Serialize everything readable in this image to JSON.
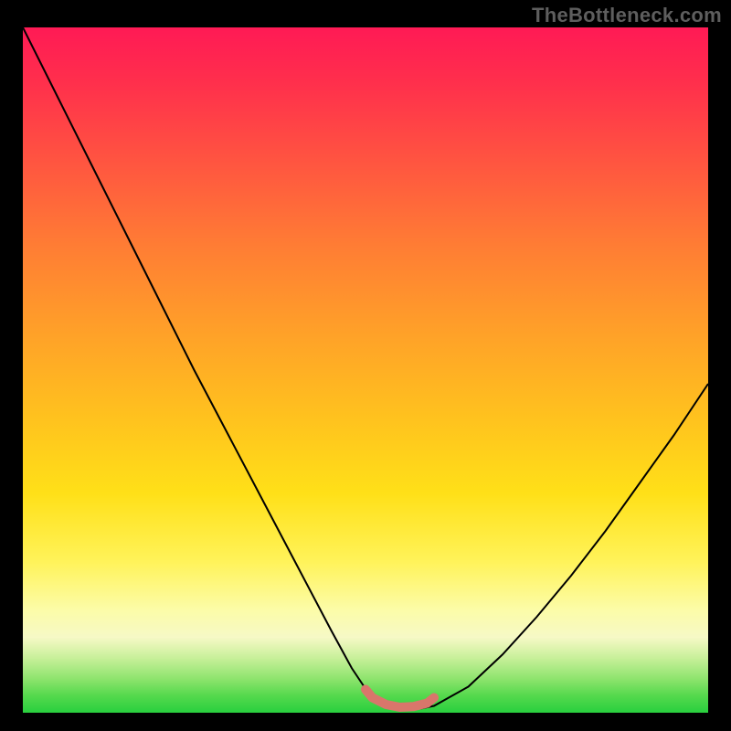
{
  "attribution": "TheBottleneck.com",
  "chart_data": {
    "type": "line",
    "title": "",
    "xlabel": "",
    "ylabel": "",
    "xlim": [
      0,
      100
    ],
    "ylim": [
      0,
      100
    ],
    "grid": false,
    "legend": false,
    "background_gradient_stops": [
      {
        "pos": 0,
        "color": "#ff1a55"
      },
      {
        "pos": 20,
        "color": "#ff5640"
      },
      {
        "pos": 45,
        "color": "#ffa228"
      },
      {
        "pos": 68,
        "color": "#ffe018"
      },
      {
        "pos": 85,
        "color": "#fcfca8"
      },
      {
        "pos": 95,
        "color": "#8fe46e"
      },
      {
        "pos": 100,
        "color": "#28cf3e"
      }
    ],
    "series": [
      {
        "name": "bottleneck-curve",
        "color": "#000000",
        "stroke_width": 2,
        "x": [
          0,
          5,
          10,
          15,
          20,
          25,
          30,
          35,
          40,
          45,
          48,
          50,
          52,
          55,
          58,
          60,
          65,
          70,
          75,
          80,
          85,
          90,
          95,
          100
        ],
        "y": [
          100,
          90,
          80,
          70,
          60,
          50,
          40.5,
          31,
          21.5,
          12,
          6.5,
          3.5,
          1.8,
          0.8,
          0.6,
          1.0,
          3.8,
          8.5,
          14,
          20,
          26.5,
          33.5,
          40.5,
          48
        ]
      },
      {
        "name": "bottom-marker",
        "color": "#d9766b",
        "stroke_width": 10,
        "linecap": "round",
        "x": [
          50,
          51,
          53,
          55,
          57,
          59,
          60
        ],
        "y": [
          3.4,
          2.2,
          1.2,
          0.8,
          0.9,
          1.4,
          2.2
        ]
      }
    ]
  }
}
